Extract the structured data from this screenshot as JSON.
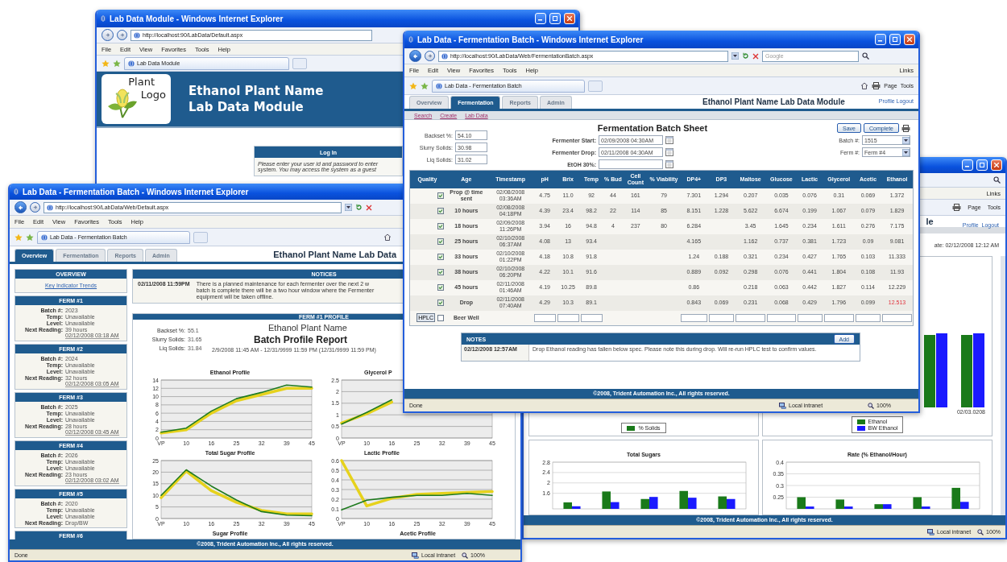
{
  "login_window": {
    "title": "Lab Data Module - Windows Internet Explorer",
    "url": "http://localhost:90/LabData/Default.aspx",
    "menu": [
      "File",
      "Edit",
      "View",
      "Favorites",
      "Tools",
      "Help"
    ],
    "tab": "Lab Data Module",
    "logo": [
      "Plant",
      "Logo"
    ],
    "heading": [
      "Ethanol Plant Name",
      "Lab Data Module"
    ],
    "login": {
      "title": "Log In",
      "lines": [
        "Please enter your user id and password to enter",
        "system. You may access the system as a guest"
      ]
    }
  },
  "reports_window": {
    "menu_right": "Links",
    "toolbar": [
      "Page",
      "Tools"
    ],
    "heading": "le",
    "user_links": [
      "Profile",
      "Logout"
    ],
    "date": "ate: 02/12/2008 12:12 AM",
    "top_charts": [
      {
        "legend": [
          {
            "label": "% Solids",
            "color": "#1a7a1a"
          }
        ]
      },
      {
        "category": "02/03.0208",
        "legend": [
          {
            "label": "Ethanol",
            "color": "#1a7a1a"
          },
          {
            "label": "BW Ethanol",
            "color": "#1a1aff"
          }
        ]
      }
    ],
    "bottom_charts": [
      {
        "chart_data": {
          "type": "bar",
          "title": "Total Sugars",
          "grid": true,
          "ylim": [
            1,
            2.8
          ],
          "yticks": [
            1.6,
            2,
            2.4,
            2.8
          ],
          "series": [
            {
              "color": "#1a7a1a",
              "values": [
                1.25,
                1.67,
                1.38,
                1.69,
                1.48
              ]
            },
            {
              "color": "#1a1aff",
              "values": [
                1.1,
                1.26,
                1.46,
                1.43,
                1.38
              ]
            }
          ]
        }
      },
      {
        "chart_data": {
          "type": "bar",
          "title": "Rate (% Ethanol/Hour)",
          "grid": true,
          "ylim": [
            0.2,
            0.4
          ],
          "yticks": [
            0.25,
            0.3,
            0.35,
            0.4
          ],
          "series": [
            {
              "color": "#1a7a1a",
              "values": [
                0.25,
                0.24,
                0.22,
                0.25,
                0.29
              ]
            },
            {
              "color": "#1a1aff",
              "values": [
                0.21,
                0.21,
                0.22,
                0.21,
                0.23
              ]
            }
          ]
        }
      }
    ],
    "footer": "©2008, Trident Automation Inc., All rights reserved.",
    "status": [
      "Local intranet",
      "100%"
    ]
  },
  "overview_window": {
    "title": "Lab Data - Fermentation Batch - Windows Internet Explorer",
    "url": "http://localhost:90/LabData/Web/Default.aspx",
    "menu": [
      "File",
      "Edit",
      "View",
      "Favorites",
      "Tools",
      "Help"
    ],
    "tab": "Lab Data - Fermentation Batch",
    "tabs": [
      {
        "label": "Overview",
        "selected": true
      },
      {
        "label": "Fermentation",
        "selected": false
      },
      {
        "label": "Reports",
        "selected": false
      },
      {
        "label": "Admin",
        "selected": false
      }
    ],
    "heading": "Ethanol Plant Name Lab Data",
    "overview": {
      "title": "OVERVIEW",
      "link": "Key Indicator Trends"
    },
    "ferms": [
      {
        "title": "FERM #1",
        "fields": [
          {
            "label": "Batch #:",
            "value": "2023"
          },
          {
            "label": "Temp:",
            "value": "Unavailable"
          },
          {
            "label": "Level:",
            "value": "Unavailable"
          },
          {
            "label": "Next Reading:",
            "value": "39 hours"
          }
        ],
        "time": "02/12/2008 03:18 AM"
      },
      {
        "title": "FERM #2",
        "fields": [
          {
            "label": "Batch #:",
            "value": "2024"
          },
          {
            "label": "Temp:",
            "value": "Unavailable"
          },
          {
            "label": "Level:",
            "value": "Unavailable"
          },
          {
            "label": "Next Reading:",
            "value": "32 hours"
          }
        ],
        "time": "02/12/2008 03:05 AM"
      },
      {
        "title": "FERM #3",
        "fields": [
          {
            "label": "Batch #:",
            "value": "2025"
          },
          {
            "label": "Temp:",
            "value": "Unavailable"
          },
          {
            "label": "Level:",
            "value": "Unavailable"
          },
          {
            "label": "Next Reading:",
            "value": "28 hours"
          }
        ],
        "time": "02/12/2008 03:45 AM"
      },
      {
        "title": "FERM #4",
        "fields": [
          {
            "label": "Batch #:",
            "value": "2026"
          },
          {
            "label": "Temp:",
            "value": "Unavailable"
          },
          {
            "label": "Level:",
            "value": "Unavailable"
          },
          {
            "label": "Next Reading:",
            "value": "23 hours"
          }
        ],
        "time": "02/12/2008 03:02 AM"
      },
      {
        "title": "FERM #5",
        "fields": [
          {
            "label": "Batch #:",
            "value": "2020"
          },
          {
            "label": "Temp:",
            "value": "Unavailable"
          },
          {
            "label": "Level:",
            "value": "Unavailable"
          },
          {
            "label": "Next Reading:",
            "value": "Drop/BW"
          }
        ]
      },
      {
        "title": "FERM #6"
      }
    ],
    "notices": {
      "title": "NOTICES",
      "items": [
        {
          "date": "02/11/2008 11:59PM",
          "lines": [
            "There is a planned maintenance for each fermenter over the next 2 w",
            "batch is complete there will be a two hour window where the Fermenter",
            "equipment will be taken offline."
          ]
        }
      ]
    },
    "profile": {
      "title": "FERM #1 PROFILE",
      "stats": [
        {
          "label": "Backset %:",
          "value": "55.1"
        },
        {
          "label": "Slurry Solids:",
          "value": "31.65"
        },
        {
          "label": "Liq Solids:",
          "value": "31.84"
        }
      ],
      "plant": "Ethanol Plant Name",
      "report": "Batch Profile Report",
      "range": "2/9/2008 11:45 AM - 12/31/9999 11:59 PM (12/31/9999 11:59 PM)",
      "charts": [
        {
          "chart_data": {
            "type": "line",
            "title": "Ethanol Profile",
            "grid": true,
            "categories": [
              "VP",
              "10",
              "16",
              "25",
              "32",
              "39",
              "45"
            ],
            "ylim": [
              0,
              14
            ],
            "yticks": [
              0,
              2,
              4,
              6,
              8,
              10,
              12,
              14
            ],
            "series": [
              {
                "color": "#1e7a1e",
                "values": [
                  1.4,
                  2.4,
                  6.5,
                  9.5,
                  11,
                  12.8,
                  12.3
                ]
              },
              {
                "color": "#e6d21c",
                "values": [
                  1.2,
                  2,
                  6,
                  9,
                  10.5,
                  12,
                  12
                ]
              }
            ]
          }
        },
        {
          "chart_data": {
            "type": "line",
            "title": "Glycerol P",
            "grid": true,
            "categories": [
              "VP",
              "10",
              "16",
              "25",
              "32",
              "39",
              "45"
            ],
            "ylim": [
              0,
              2.5
            ],
            "yticks": [
              0,
              0.5,
              1,
              1.5,
              2,
              2.5
            ],
            "series": [
              {
                "color": "#1e7a1e",
                "values": [
                  0.6,
                  1.1,
                  1.65,
                  null,
                  null,
                  null,
                  null
                ]
              },
              {
                "color": "#e6d21c",
                "values": [
                  0.65,
                  1.05,
                  1.55,
                  null,
                  null,
                  null,
                  null
                ]
              }
            ]
          }
        },
        {
          "chart_data": {
            "type": "line",
            "title": "Total Sugar Profile",
            "grid": true,
            "categories": [
              "VP",
              "10",
              "16",
              "25",
              "32",
              "39",
              "45"
            ],
            "ylim": [
              0,
              25
            ],
            "yticks": [
              0,
              5,
              10,
              15,
              20,
              25
            ],
            "series": [
              {
                "color": "#1e7a1e",
                "values": [
                  10,
                  21,
                  14,
                  8,
                  3,
                  1.5,
                  1.2
                ]
              },
              {
                "color": "#e6d21c",
                "values": [
                  9,
                  20.5,
                  12,
                  7,
                  3.5,
                  2,
                  2
                ]
              }
            ]
          }
        },
        {
          "chart_data": {
            "type": "line",
            "title": "Lactic Profile",
            "grid": true,
            "categories": [
              "VP",
              "10",
              "16",
              "25",
              "32",
              "39",
              "45"
            ],
            "ylim": [
              0,
              0.6
            ],
            "yticks": [
              0,
              0.1,
              0.2,
              0.3,
              0.4,
              0.5,
              0.6
            ],
            "series": [
              {
                "color": "#1e7a1e",
                "values": [
                  0.09,
                  0.19,
                  0.22,
                  0.24,
                  0.24,
                  0.26,
                  0.24
                ]
              },
              {
                "color": "#e6d21c",
                "values": [
                  0.6,
                  0.13,
                  0.21,
                  0.25,
                  0.26,
                  0.27,
                  0.28
                ]
              }
            ]
          }
        }
      ],
      "more_charts": [
        "Sugar Profile",
        "Acetic Profile"
      ]
    },
    "footer": "©2008, Trident Automation Inc., All rights reserved.",
    "status": [
      "Done",
      "Local intranet",
      "100%"
    ]
  },
  "batch_window": {
    "title": "Lab Data - Fermentation Batch - Windows Internet Explorer",
    "url": "http://localhost:90/LabData/Web/FermentationBatch.aspx",
    "search_placeholder": "Google",
    "menu": [
      "File",
      "Edit",
      "View",
      "Favorites",
      "Tools",
      "Help"
    ],
    "menu_right": "Links",
    "tab": "Lab Data - Fermentation Batch",
    "toolbar": [
      "Page",
      "Tools"
    ],
    "tabs": [
      {
        "label": "Overview",
        "selected": false
      },
      {
        "label": "Fermentation",
        "selected": true
      },
      {
        "label": "Reports",
        "selected": false
      },
      {
        "label": "Admin",
        "selected": false
      }
    ],
    "heading": "Ethanol Plant Name Lab Data Module",
    "user_links": [
      "Profile",
      "Logout"
    ],
    "subnav": [
      "Search",
      "Create",
      "Lab Data"
    ],
    "sheet_title": "Fermentation Batch Sheet",
    "solids": [
      {
        "label": "Backset %:",
        "value": "54.10"
      },
      {
        "label": "Slurry Solids:",
        "value": "30.98"
      },
      {
        "label": "Liq Solids:",
        "value": "31.02"
      }
    ],
    "dates": [
      {
        "label": "Fermenter Start:",
        "value": "02/09/2008 04:30AM"
      },
      {
        "label": "Fermenter Drop:",
        "value": "02/11/2008 04:30AM"
      },
      {
        "label": "EtOH 30%:"
      }
    ],
    "buttons": [
      "Save",
      "Complete"
    ],
    "selects": [
      {
        "label": "Batch #:",
        "value": "1515"
      },
      {
        "label": "Ferm #:",
        "value": "Ferm #4"
      }
    ],
    "table": {
      "columns": [
        "Quality",
        "Age",
        "Timestamp",
        "pH",
        "Brix",
        "Temp",
        "% Bud",
        "Cell Count",
        "% Viability",
        "DP4+",
        "DP3",
        "Maltose",
        "Glucose",
        "Lactic",
        "Glycerol",
        "Acetic",
        "Ethanol"
      ],
      "rows": [
        {
          "checked": true,
          "age": "Prop @ time sent",
          "timestamp": "02/08/2008 03:36AM",
          "values": {
            "ph": "4.75",
            "brix": "11.0",
            "temp": "92",
            "bud": "44",
            "cell_count": "161",
            "viability": "79",
            "dp4": "7.301",
            "dp3": "1.294",
            "maltose": "0.207",
            "glucose": "0.035",
            "lactic": "0.076",
            "glycerol": "0.31",
            "acetic": "0.069",
            "ethanol": "1.372"
          },
          "ethanol_alert": false
        },
        {
          "checked": true,
          "age": "10 hours",
          "timestamp": "02/08/2008 04:18PM",
          "values": {
            "ph": "4.39",
            "brix": "23.4",
            "temp": "98.2",
            "bud": "22",
            "cell_count": "114",
            "viability": "85",
            "dp4": "8.151",
            "dp3": "1.228",
            "maltose": "5.622",
            "glucose": "6.674",
            "lactic": "0.199",
            "glycerol": "1.067",
            "acetic": "0.079",
            "ethanol": "1.829"
          },
          "ethanol_alert": false
        },
        {
          "checked": true,
          "age": "18 hours",
          "timestamp": "02/09/2008 11:26PM",
          "values": {
            "ph": "3.94",
            "brix": "16",
            "temp": "94.8",
            "bud": "4",
            "cell_count": "237",
            "viability": "80",
            "dp4": "6.284",
            "maltose": "3.45",
            "glucose": "1.645",
            "lactic": "0.234",
            "glycerol": "1.611",
            "acetic": "0.276",
            "ethanol": "7.175"
          },
          "ethanol_alert": false
        },
        {
          "checked": true,
          "age": "25 hours",
          "timestamp": "02/10/2008 06:37AM",
          "values": {
            "ph": "4.08",
            "brix": "13",
            "temp": "93.4",
            "dp4": "4.165",
            "maltose": "1.162",
            "glucose": "0.737",
            "lactic": "0.381",
            "glycerol": "1.723",
            "acetic": "0.09",
            "ethanol": "9.081"
          },
          "ethanol_alert": false
        },
        {
          "checked": true,
          "age": "33 hours",
          "timestamp": "02/10/2008 01:22PM",
          "values": {
            "ph": "4.18",
            "brix": "10.8",
            "temp": "91.8",
            "dp4": "1.24",
            "dp3": "0.188",
            "maltose": "0.321",
            "glucose": "0.234",
            "lactic": "0.427",
            "glycerol": "1.765",
            "acetic": "0.103",
            "ethanol": "11.333"
          },
          "ethanol_alert": false
        },
        {
          "checked": true,
          "age": "38 hours",
          "timestamp": "02/10/2008 06:20PM",
          "values": {
            "ph": "4.22",
            "brix": "10.1",
            "temp": "91.6",
            "dp4": "0.889",
            "dp3": "0.092",
            "maltose": "0.298",
            "glucose": "0.076",
            "lactic": "0.441",
            "glycerol": "1.804",
            "acetic": "0.108",
            "ethanol": "11.93"
          },
          "ethanol_alert": false
        },
        {
          "checked": true,
          "age": "45 hours",
          "timestamp": "02/11/2008 01:46AM",
          "values": {
            "ph": "4.19",
            "brix": "10.25",
            "temp": "89.8",
            "dp4": "0.86",
            "maltose": "0.218",
            "glucose": "0.063",
            "lactic": "0.442",
            "glycerol": "1.827",
            "acetic": "0.114",
            "ethanol": "12.229"
          },
          "ethanol_alert": false
        },
        {
          "checked": true,
          "age": "Drop",
          "timestamp": "02/11/2008 07:40AM",
          "values": {
            "ph": "4.29",
            "brix": "10.3",
            "temp": "89.1",
            "dp4": "0.843",
            "dp3": "0.069",
            "maltose": "0.231",
            "glucose": "0.068",
            "lactic": "0.429",
            "glycerol": "1.796",
            "acetic": "0.099",
            "ethanol": "12.513"
          },
          "ethanol_alert": true
        }
      ],
      "beer_well": {
        "button": "HPLC",
        "checked": false,
        "age": "Beer Well"
      }
    },
    "notes": {
      "title": "NOTES",
      "button": "Add",
      "items": [
        {
          "date": "02/12/2008 12:57AM",
          "text": "Drop Ethanol reading has fallen below spec. Please note this during drop. Will re-run HPLC test to confirm values."
        }
      ]
    },
    "footer": "©2008, Trident Automation Inc., All rights reserved.",
    "status": [
      "Done",
      "Local intranet",
      "100%"
    ]
  }
}
